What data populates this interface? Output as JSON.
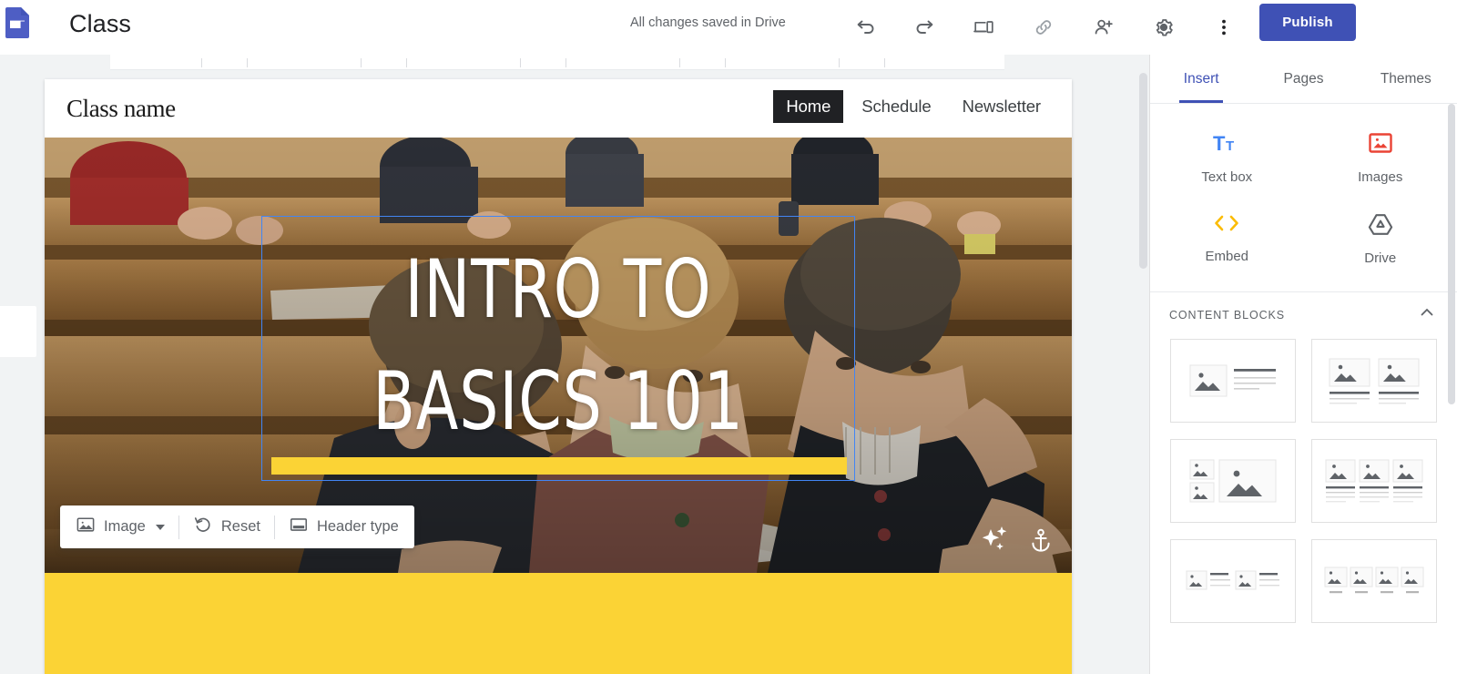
{
  "appbar": {
    "logo_icon": "google-sites-logo",
    "title": "Class",
    "save_status": "All changes saved in Drive",
    "undo_icon": "undo-arrow-icon",
    "redo_icon": "redo-arrow-icon",
    "preview_icon": "preview-devices-icon",
    "link_icon": "copy-link-icon",
    "share_icon": "add-person-icon",
    "settings_icon": "gear-icon",
    "more_icon": "more-vertical-icon",
    "publish_label": "Publish"
  },
  "site": {
    "name": "Class name",
    "nav": [
      {
        "label": "Home",
        "active": true
      },
      {
        "label": "Schedule",
        "active": false
      },
      {
        "label": "Newsletter",
        "active": false
      }
    ],
    "hero_title": "INTRO TO\nBASICS 101",
    "accent_color": "#fbd335",
    "selection_color": "#4285f4"
  },
  "image_toolbar": {
    "image_label": "Image",
    "image_icon": "image-icon",
    "dropdown_icon": "chevron-down-icon",
    "reset_label": "Reset",
    "reset_icon": "reset-rotate-icon",
    "header_type_label": "Header type",
    "header_type_icon": "header-layout-icon"
  },
  "hero_tools": {
    "sparkle_icon": "sparkle-adjust-icon",
    "anchor_icon": "anchor-icon"
  },
  "panel": {
    "tabs": [
      {
        "label": "Insert",
        "active": true
      },
      {
        "label": "Pages",
        "active": false
      },
      {
        "label": "Themes",
        "active": false
      }
    ],
    "insert_items": [
      {
        "label": "Text box",
        "icon": "text-box-icon",
        "color": "#4285f4"
      },
      {
        "label": "Images",
        "icon": "images-icon",
        "color": "#ea4335"
      },
      {
        "label": "Embed",
        "icon": "embed-code-icon",
        "color": "#fbbc04"
      },
      {
        "label": "Drive",
        "icon": "google-drive-icon",
        "color": "#5f6368"
      }
    ],
    "content_blocks": {
      "title": "CONTENT BLOCKS",
      "collapse_icon": "chevron-up-icon",
      "items": [
        {
          "name": "block-image-left-text-right"
        },
        {
          "name": "block-two-images-with-text"
        },
        {
          "name": "block-two-small-one-large-image"
        },
        {
          "name": "block-three-images-with-text"
        },
        {
          "name": "block-two-image-text-pairs"
        },
        {
          "name": "block-four-images-with-captions"
        }
      ]
    }
  }
}
